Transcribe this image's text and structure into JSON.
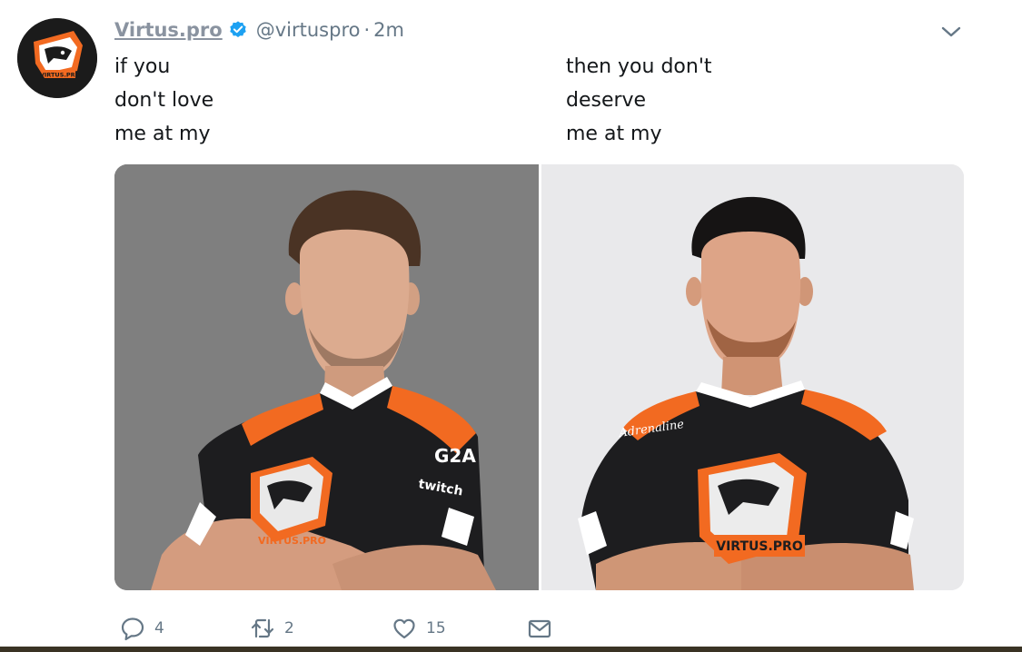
{
  "tweet": {
    "display_name": "Virtus.pro",
    "handle": "@virtuspro",
    "separator": "·",
    "time": "2m",
    "verified_icon": "verified-badge-icon",
    "caret_icon": "chevron-down-icon",
    "text_left": [
      "if you",
      "don't love",
      "me at my"
    ],
    "text_right": [
      "then you don't",
      "deserve",
      "me at my"
    ]
  },
  "avatar": {
    "icon": "virtus-pro-bear-logo",
    "logo_text": "VIRTUS.PRO"
  },
  "media": {
    "left_photo": {
      "icon": "player-photo-gray-background",
      "jersey_text": "VIRTUS.PRO",
      "sponsor_1": "G2A",
      "sponsor_2": "twitch"
    },
    "right_photo": {
      "icon": "player-photo-white-background",
      "jersey_text": "VIRTUS.PRO",
      "sponsor_1": "Adrenaline"
    }
  },
  "actions": {
    "reply_count": "4",
    "retweet_count": "2",
    "like_count": "15",
    "reply_icon": "reply-icon",
    "retweet_icon": "retweet-icon",
    "like_icon": "heart-icon",
    "dm_icon": "envelope-icon"
  },
  "colors": {
    "name": "#8a93a0",
    "meta": "#657786",
    "verified": "#1da1f2",
    "brand_orange": "#f26a21",
    "jersey_black": "#1d1d1f"
  }
}
